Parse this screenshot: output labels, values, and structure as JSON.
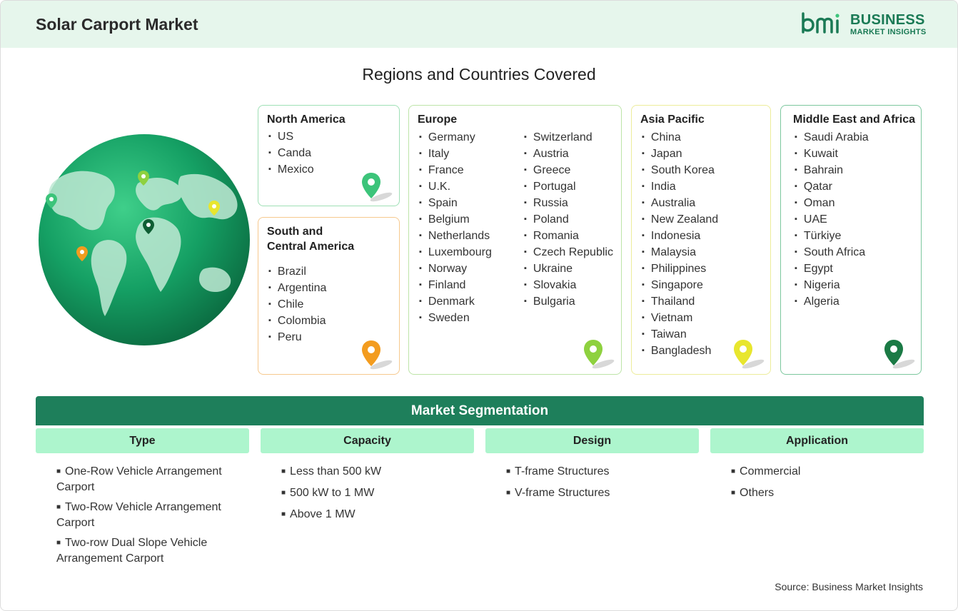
{
  "header": {
    "title": "Solar Carport Market",
    "logo_line1": "BUSINESS",
    "logo_line2": "MARKET INSIGHTS",
    "logo_mark": "bmi"
  },
  "regions": {
    "title": "Regions and Countries Covered",
    "north_america": {
      "title": "North America",
      "items": [
        "US",
        "Canda",
        "Mexico"
      ],
      "pin_color": "#3cc47a"
    },
    "south_america": {
      "title_line1": "South and",
      "title_line2": "Central America",
      "items": [
        "Brazil",
        "Argentina",
        "Chile",
        "Colombia",
        "Peru"
      ],
      "pin_color": "#f39c1f"
    },
    "europe": {
      "title": "Europe",
      "col1": [
        "Germany",
        "Italy",
        "France",
        "U.K.",
        "Spain",
        "Belgium",
        "Netherlands",
        "Luxembourg",
        "Norway",
        "Finland",
        "Denmark",
        "Sweden"
      ],
      "col2": [
        "Switzerland",
        "Austria",
        "Greece",
        "Portugal",
        "Russia",
        "Poland",
        "Romania",
        "Czech Republic",
        "Ukraine",
        "Slovakia",
        "Bulgaria"
      ],
      "pin_color": "#8ed13f"
    },
    "asia_pacific": {
      "title": "Asia Pacific",
      "items": [
        "China",
        "Japan",
        "South Korea",
        "India",
        "Australia",
        "New Zealand",
        "Indonesia",
        "Malaysia",
        "Philippines",
        "Singapore",
        "Thailand",
        "Vietnam",
        "Taiwan",
        "Bangladesh"
      ],
      "pin_color": "#e8e62e"
    },
    "middle_east_africa": {
      "title": "Middle East and Africa",
      "items": [
        "Saudi Arabia",
        "Kuwait",
        "Bahrain",
        "Qatar",
        "Oman",
        "UAE",
        "Türkiye",
        "South Africa",
        "Egypt",
        "Nigeria",
        "Algeria"
      ],
      "pin_color": "#1b7a45"
    }
  },
  "segmentation": {
    "title": "Market Segmentation",
    "type": {
      "label": "Type",
      "items": [
        "One-Row Vehicle Arrangement Carport",
        "Two-Row Vehicle Arrangement Carport",
        "Two-row Dual Slope Vehicle Arrangement Carport"
      ]
    },
    "capacity": {
      "label": "Capacity",
      "items": [
        "Less than 500 kW",
        "500 kW to 1 MW",
        "Above 1 MW"
      ]
    },
    "design": {
      "label": "Design",
      "items": [
        "T-frame Structures",
        "V-frame Structures"
      ]
    },
    "application": {
      "label": "Application",
      "items": [
        "Commercial",
        "Others"
      ]
    }
  },
  "source": "Source: Business Market Insights",
  "colors": {
    "header_bg": "#e6f6ec",
    "brand": "#1a7a55",
    "segment_bar": "#1e7f5b",
    "segment_head": "#adf5cd"
  }
}
